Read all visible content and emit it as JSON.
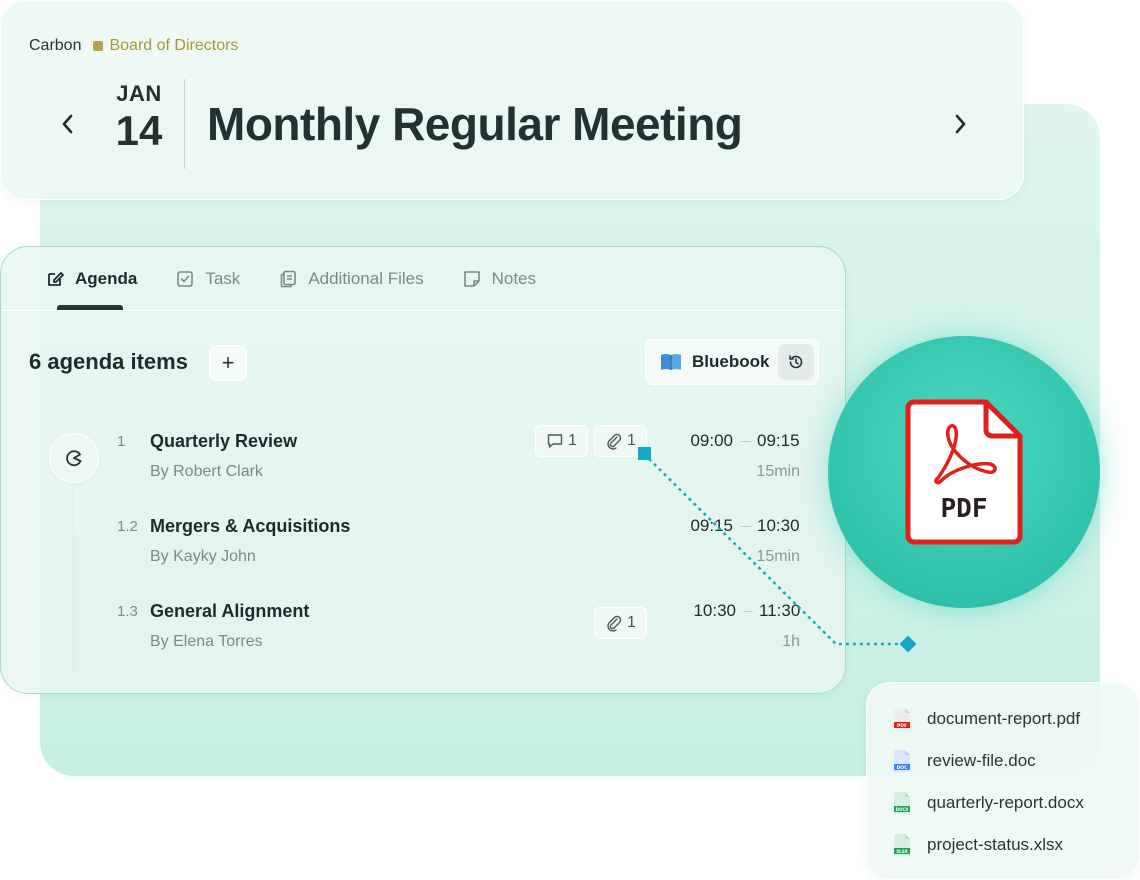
{
  "header": {
    "org": "Carbon",
    "board": "Board of Directors",
    "board_color": "#b2a54a",
    "month": "JAN",
    "day": "14",
    "title": "Monthly Regular Meeting"
  },
  "tabs": [
    {
      "label": "Agenda",
      "icon": "agenda-icon",
      "active": true
    },
    {
      "label": "Task",
      "icon": "task-checkbox-icon",
      "active": false
    },
    {
      "label": "Additional Files",
      "icon": "files-icon",
      "active": false
    },
    {
      "label": "Notes",
      "icon": "notes-icon",
      "active": false
    }
  ],
  "agenda": {
    "count_label": "6 agenda items",
    "add_symbol": "+",
    "bluebook_label": "Bluebook",
    "items": [
      {
        "num": "1",
        "title": "Quarterly Review",
        "by": "By Robert Clark",
        "comments": "1",
        "attachments": "1",
        "start": "09:00",
        "end": "09:15",
        "duration": "15min"
      },
      {
        "num": "1.2",
        "title": "Mergers & Acquisitions",
        "by": "By Kayky John",
        "start": "09:15",
        "end": "10:30",
        "duration": "15min"
      },
      {
        "num": "1.3",
        "title": "General Alignment",
        "by": "By Elena Torres",
        "attachments": "1",
        "start": "10:30",
        "end": "11:30",
        "duration": "1h"
      }
    ]
  },
  "pdf_badge": {
    "label": "PDF",
    "accent": "#e0201b"
  },
  "files": [
    {
      "name": "document-report.pdf",
      "type": "PDF",
      "color": "#e0201b"
    },
    {
      "name": "review-file.doc",
      "type": "DOC",
      "color": "#3b82f6"
    },
    {
      "name": "quarterly-report.docx",
      "type": "DOCX",
      "color": "#22a05a"
    },
    {
      "name": "project-status.xlsx",
      "type": "XLSX",
      "color": "#22a05a"
    }
  ],
  "colors": {
    "accent_teal": "#17a9c2",
    "mint": "#c7efe3"
  }
}
